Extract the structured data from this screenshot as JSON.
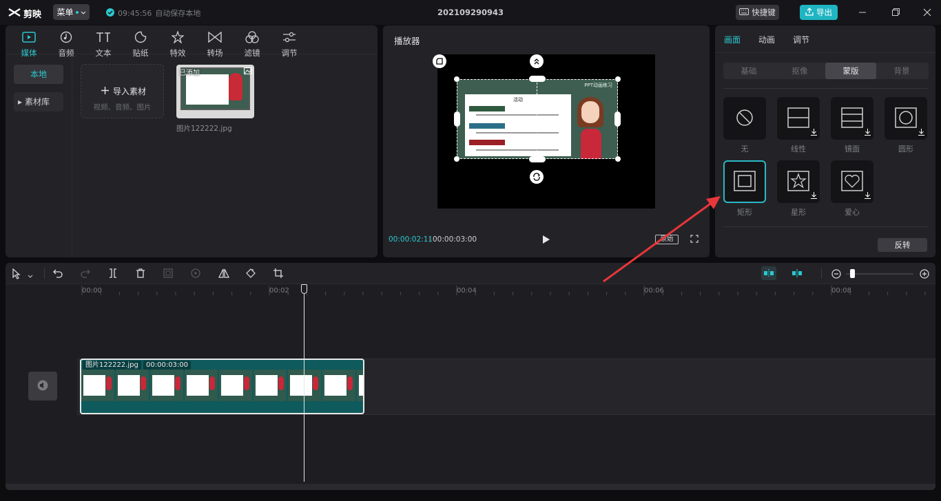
{
  "app": {
    "name": "剪映",
    "menu_label": "菜单",
    "autosave_time": "09:45:56",
    "autosave_text": "自动保存本地",
    "project_title": "202109290943",
    "shortcut_label": "快捷键",
    "export_label": "导出"
  },
  "toolbar": {
    "tabs": [
      {
        "label": "媒体"
      },
      {
        "label": "音频"
      },
      {
        "label": "文本"
      },
      {
        "label": "贴纸"
      },
      {
        "label": "特效"
      },
      {
        "label": "转场"
      },
      {
        "label": "滤镜"
      },
      {
        "label": "调节"
      }
    ],
    "active": "媒体"
  },
  "media": {
    "local_label": "本地",
    "library_label": "素材库",
    "import_label": "导入素材",
    "import_hint": "视频、音频、图片",
    "file_name": "图片122222.jpg",
    "added_badge": "已添加"
  },
  "player": {
    "title": "播放器",
    "current_time": "00:00:02:11",
    "total_time": "00:00:03:00",
    "ratio_label": "原始",
    "slide_heading": "活动",
    "slide_banner": "PPT动画练习"
  },
  "props": {
    "tabs": [
      {
        "label": "画面"
      },
      {
        "label": "动画"
      },
      {
        "label": "调节"
      }
    ],
    "subtabs": [
      {
        "label": "基础"
      },
      {
        "label": "抠像"
      },
      {
        "label": "蒙版"
      },
      {
        "label": "背景"
      }
    ],
    "active_subtab": "蒙版",
    "masks": [
      {
        "label": "无"
      },
      {
        "label": "线性"
      },
      {
        "label": "镜面"
      },
      {
        "label": "圆形"
      },
      {
        "label": "矩形"
      },
      {
        "label": "星形"
      },
      {
        "label": "爱心"
      }
    ],
    "selected_mask": "矩形",
    "invert_label": "反转"
  },
  "timeline": {
    "ruler": [
      "00:00",
      "00:02",
      "00:04",
      "00:06",
      "00:08"
    ],
    "clip_name": "图片122222.jpg",
    "clip_duration": "00:00:03:00",
    "playhead_time_sec": 2.37
  },
  "colors": {
    "accent": "#2bc8d0",
    "arrow": "#e8363a",
    "clip": "#0e5a5c",
    "board": "#3d5e50"
  }
}
